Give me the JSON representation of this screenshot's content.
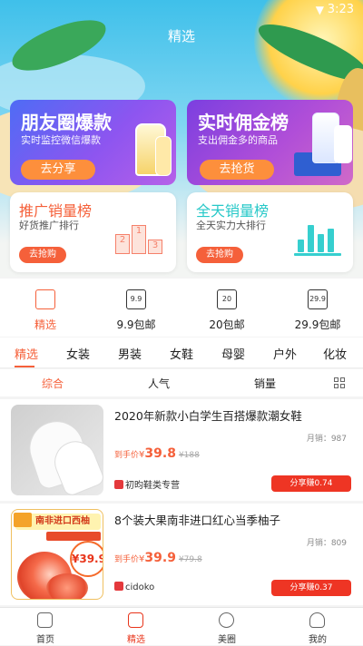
{
  "status": {
    "time": "3:23"
  },
  "header": {
    "title": "精选"
  },
  "banners": [
    {
      "title": "朋友圈爆款",
      "subtitle": "实时监控微信爆款",
      "button": "去分享"
    },
    {
      "title": "实时佣金榜",
      "subtitle": "支出佣金多的商品",
      "button": "去抢货"
    }
  ],
  "rank_cards": [
    {
      "title": "推广销量榜",
      "subtitle": "好货推广排行",
      "button": "去抢购",
      "podium": [
        "2",
        "1",
        "3"
      ]
    },
    {
      "title": "全天销量榜",
      "subtitle": "全天实力大排行",
      "button": "去抢购"
    }
  ],
  "categories": [
    {
      "label": "精选",
      "icon": "star-flag-icon",
      "icon_text": ""
    },
    {
      "label": "9.9包邮",
      "icon": "tag-icon",
      "icon_text": "9.9"
    },
    {
      "label": "20包邮",
      "icon": "bag-icon",
      "icon_text": "20"
    },
    {
      "label": "29.9包邮",
      "icon": "calendar-icon",
      "icon_text": "29.9"
    }
  ],
  "tabs": [
    "精选",
    "女装",
    "男装",
    "女鞋",
    "母婴",
    "户外",
    "化妆"
  ],
  "sorts": [
    "综合",
    "人气",
    "销量"
  ],
  "products": [
    {
      "title": "2020年新款小白学生百搭爆款潮女鞋",
      "sales": "月销：987",
      "price_label": "到手价",
      "yen": "¥",
      "price": "39.8",
      "original": "¥188",
      "shop": "初昀鞋类专营",
      "share": "分享赚0.74"
    },
    {
      "title": "8个装大果南非进口红心当季柚子",
      "sales": "月销：809",
      "price_label": "到手价",
      "yen": "¥",
      "price": "39.9",
      "original": "¥79.8",
      "shop": "cidoko",
      "share": "分享赚0.37",
      "thumb_banner": "南非进口西柚",
      "thumb_price": "¥39.9"
    }
  ],
  "bottom_nav": [
    {
      "label": "首页",
      "icon": "home-icon"
    },
    {
      "label": "精选",
      "icon": "book-icon"
    },
    {
      "label": "美圈",
      "icon": "chat-icon"
    },
    {
      "label": "我的",
      "icon": "user-icon"
    }
  ],
  "colors": {
    "accent": "#f5603a",
    "share": "#ee3524",
    "teal": "#27c8c8"
  }
}
